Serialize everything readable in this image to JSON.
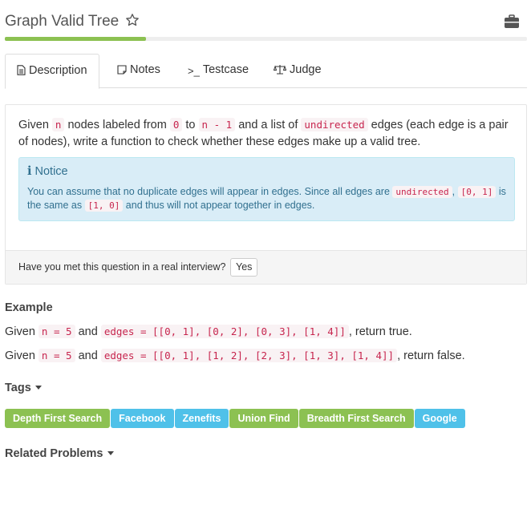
{
  "problem": {
    "title": "Graph Valid Tree",
    "progress_pct": 27
  },
  "tabs": [
    {
      "label": "Description",
      "icon": "file-icon"
    },
    {
      "label": "Notes",
      "icon": "note-icon"
    },
    {
      "label": "Testcase",
      "icon": "terminal-icon"
    },
    {
      "label": "Judge",
      "icon": "scale-icon"
    }
  ],
  "description": {
    "t1": "Given ",
    "c1": "n",
    "t2": " nodes labeled from ",
    "c2": "0",
    "t3": " to ",
    "c3": "n - 1",
    "t4": " and a list of ",
    "c4": "undirected",
    "t5": " edges (each edge is a pair of nodes), write a function to check whether these edges make up a valid tree."
  },
  "notice": {
    "title": "Notice",
    "b1": "You can assume that no duplicate edges will appear in edges. Since all edges are ",
    "bc1": "undirected",
    "b2": ", ",
    "bc2": "[0, 1]",
    "b3": " is the same as ",
    "bc3": "[1, 0]",
    "b4": " and thus will not appear together in edges."
  },
  "interview": {
    "question": "Have you met this question in a real interview?",
    "yes_label": "Yes"
  },
  "example": {
    "heading": "Example",
    "line1": {
      "given": "Given",
      "n": "n = 5",
      "and": "and",
      "edges": "edges = [[0, 1], [0, 2], [0, 3], [1, 4]]",
      "result": ", return true."
    },
    "line2": {
      "given": "Given",
      "n": "n = 5",
      "and": "and",
      "edges": "edges = [[0, 1], [1, 2], [2, 3], [1, 3], [1, 4]]",
      "result": ", return false."
    }
  },
  "tags_section": {
    "heading": "Tags",
    "items": [
      {
        "label": "Depth First Search",
        "color": "#8cc152"
      },
      {
        "label": "Facebook",
        "color": "#4fc1e9"
      },
      {
        "label": "Zenefits",
        "color": "#4fc1e9"
      },
      {
        "label": "Union Find",
        "color": "#8cc152"
      },
      {
        "label": "Breadth First Search",
        "color": "#8cc152"
      },
      {
        "label": "Google",
        "color": "#4fc1e9"
      }
    ]
  },
  "related": {
    "heading": "Related Problems"
  },
  "colors": {
    "accent_green": "#8cc152",
    "accent_blue": "#4fc1e9",
    "code_red": "#c7254e"
  }
}
